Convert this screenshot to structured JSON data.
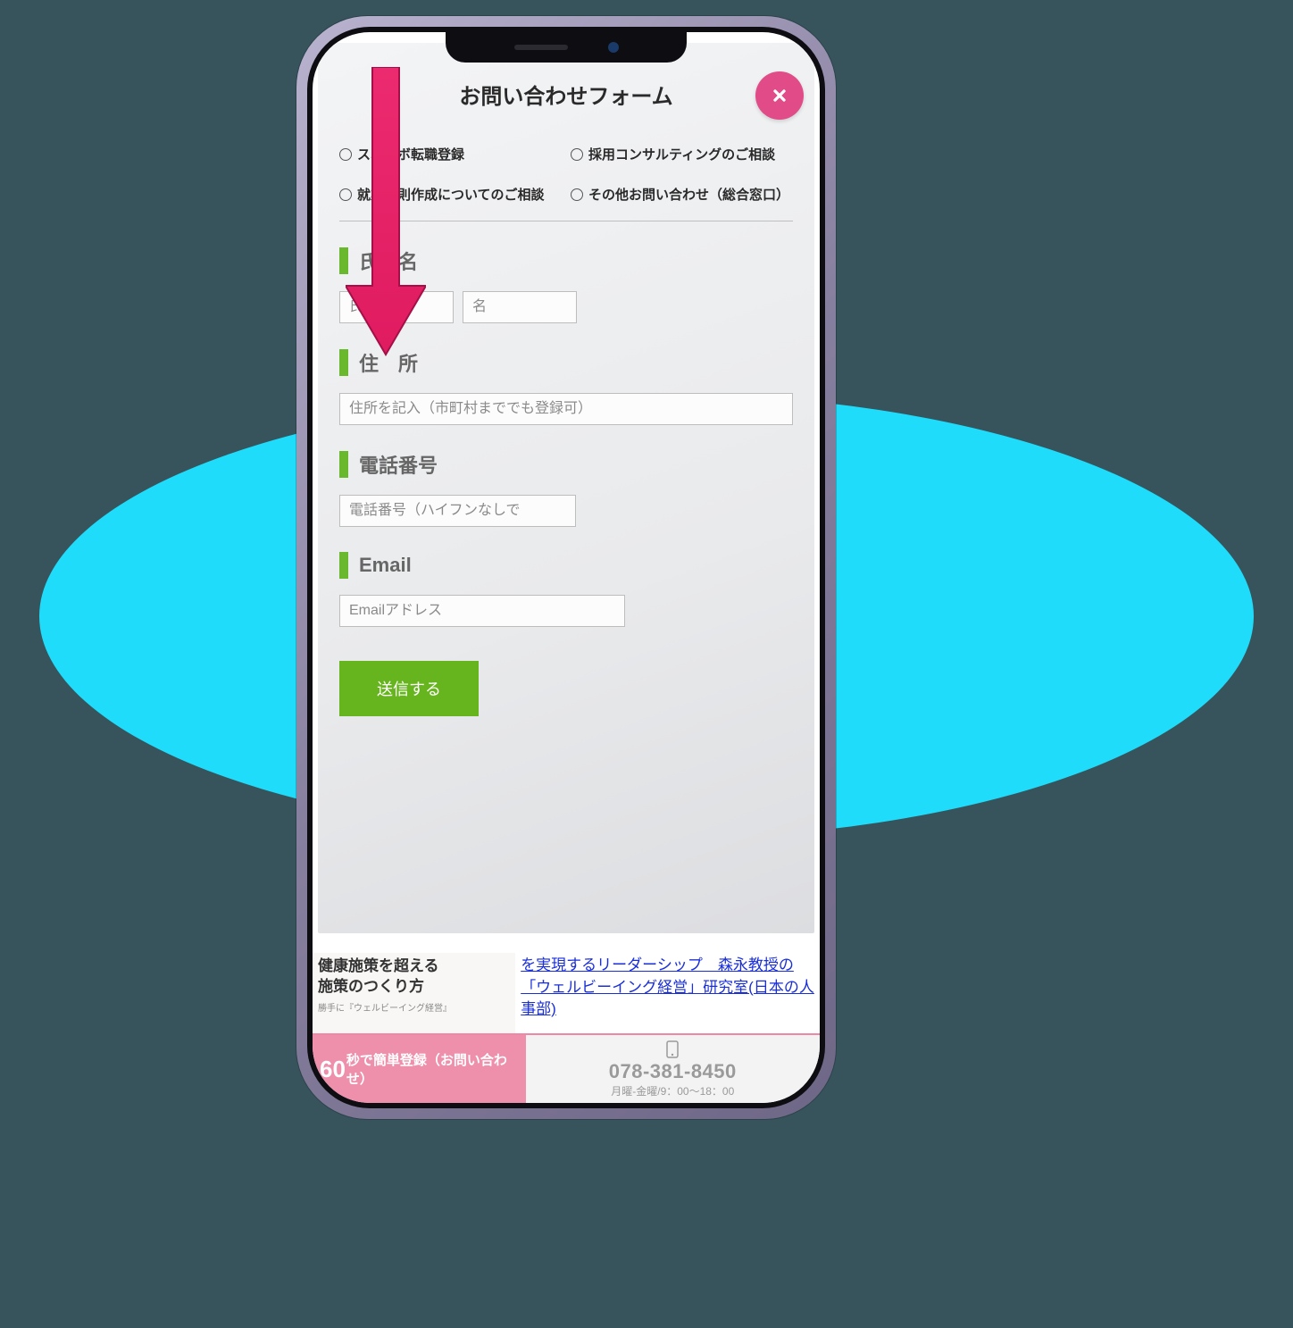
{
  "modal": {
    "title": "お問い合わせフォーム",
    "radios": {
      "opt1": "スポラボ転職登録",
      "opt2": "採用コンサルティングのご相談",
      "opt3": "就業規則作成についてのご相談",
      "opt4": "その他お問い合わせ（総合窓口）"
    },
    "sections": {
      "name": {
        "label": "氏　名",
        "ph_last": "氏",
        "ph_first": "名"
      },
      "address": {
        "label": "住　所",
        "ph": "住所を記入（市町村まででも登録可）"
      },
      "phone": {
        "label": "電話番号",
        "ph": "電話番号（ハイフンなしで"
      },
      "email": {
        "label": "Email",
        "ph": "Emailアドレス"
      }
    },
    "submit": "送信する"
  },
  "bg": {
    "article_left_line1": "健康施策を超える",
    "article_left_line2": "施策のつくり方",
    "article_left_sub": "勝手に『ウェルビーイング経営』",
    "article_right": "を実現するリーダーシップ　森永教授の「ウェルビーイング経営」研究室(日本の人事部)"
  },
  "cta": {
    "left_big": "60",
    "left_text": "秒で簡単登録（お問い合わせ）",
    "phone": "078-381-8450",
    "hours": "月曜-金曜/9：00～18：00"
  }
}
